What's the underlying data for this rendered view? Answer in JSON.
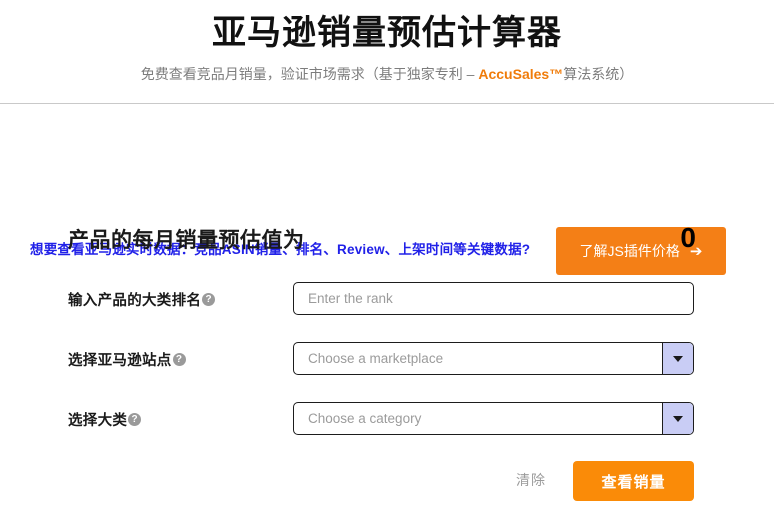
{
  "header": {
    "title": "亚马逊销量预估计算器",
    "subtitle_before": "免费查看竞品月销量，验证市场需求（基于独家专利 – ",
    "subtitle_brand": "AccuSales™",
    "subtitle_after": "算法系统）"
  },
  "promo": {
    "link_text": "想要查看亚马逊实时数据：竞品ASIN销量、排名、Review、上架时间等关键数据?",
    "button_label": "了解JS插件价格",
    "button_arrow_icon": "arrow-right-icon",
    "button_arrow_glyph": "➔",
    "link_color": "#2121e8",
    "button_color": "#f47f16"
  },
  "result": {
    "label": "产品的每月销量预估值为",
    "value": "0"
  },
  "form": {
    "help_icon_glyph": "?",
    "help_icon_name": "help-circle-icon",
    "rows": [
      {
        "label": "输入产品的大类排名",
        "name": "rank",
        "placeholder": "Enter the rank",
        "value": "",
        "type": "text",
        "has_dropdown": false
      },
      {
        "label": "选择亚马逊站点",
        "name": "marketplace",
        "placeholder": "Choose a marketplace",
        "value": "",
        "type": "select",
        "has_dropdown": true
      },
      {
        "label": "选择大类",
        "name": "category",
        "placeholder": "Choose a category",
        "value": "",
        "type": "select",
        "has_dropdown": true
      }
    ]
  },
  "actions": {
    "clear_label": "清除",
    "submit_label": "查看销量",
    "submit_color": "#fa8b08"
  }
}
